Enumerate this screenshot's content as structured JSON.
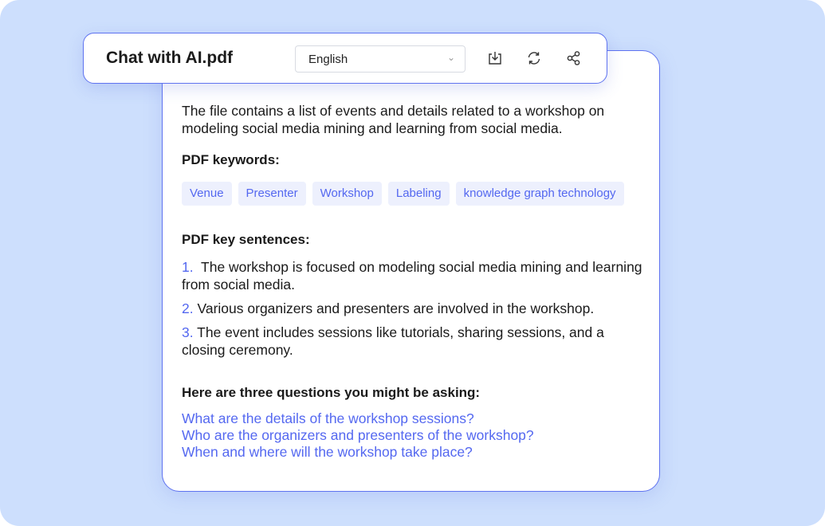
{
  "header": {
    "title": "Chat with AI.pdf",
    "language": "English",
    "icons": [
      "download-icon",
      "refresh-icon",
      "share-icon"
    ]
  },
  "summary": "The file contains a list of events and details related to a workshop on modeling social media mining and learning from social media.",
  "keywords_heading": "PDF keywords:",
  "keywords": [
    "Venue",
    "Presenter",
    "Workshop",
    "Labeling",
    "knowledge graph technology"
  ],
  "sentences_heading": "PDF key sentences:",
  "sentences": [
    {
      "num": "1.",
      "text": "The workshop is focused on modeling social media mining and learning from social media."
    },
    {
      "num": "2.",
      "text": "Various organizers and presenters are involved in the workshop."
    },
    {
      "num": "3.",
      "text": "The event includes sessions like tutorials, sharing sessions, and a closing ceremony."
    }
  ],
  "questions_heading": "Here are three questions you might be asking:",
  "questions": [
    "What are the details of the workshop sessions?",
    "Who are the organizers and presenters of the workshop?",
    "When and where will the workshop take place?"
  ],
  "colors": {
    "accent": "#5468f0",
    "background": "#cddffd"
  }
}
